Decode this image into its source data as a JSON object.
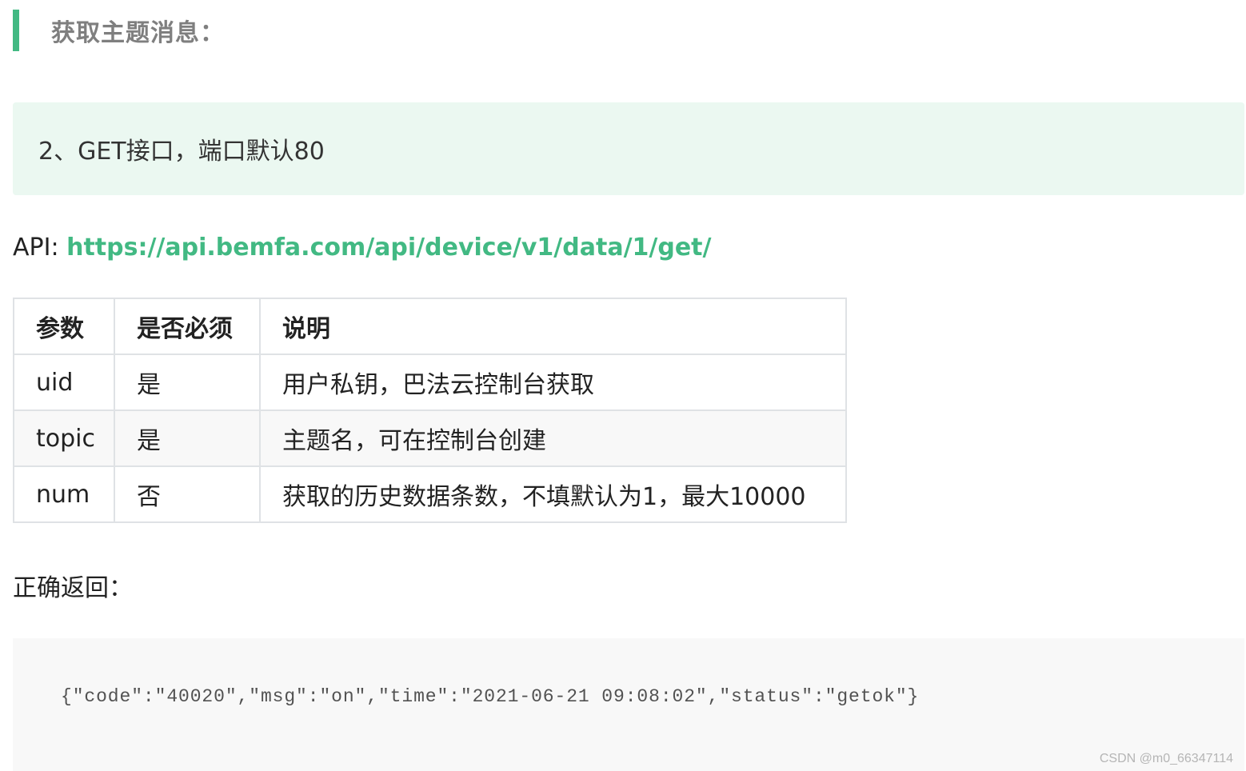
{
  "heading": {
    "text": "获取主题消息："
  },
  "tip": {
    "text": "2、GET接口，端口默认80"
  },
  "api": {
    "label": "API: ",
    "url": "https://api.bemfa.com/api/device/v1/data/1/get/"
  },
  "table": {
    "headers": [
      "参数",
      "是否必须",
      "说明"
    ],
    "rows": [
      [
        "uid",
        "是",
        "用户私钥，巴法云控制台获取"
      ],
      [
        "topic",
        "是",
        "主题名，可在控制台创建"
      ],
      [
        "num",
        "否",
        "获取的历史数据条数，不填默认为1，最大10000"
      ]
    ]
  },
  "return_label": "正确返回：",
  "code": {
    "text": "{\"code\":\"40020\",\"msg\":\"on\",\"time\":\"2021-06-21 09:08:02\",\"status\":\"getok\"}"
  },
  "watermark": "CSDN @m0_66347114",
  "colors": {
    "accent": "#42b983",
    "tip_background": "#ebf8f1",
    "code_background": "#f8f8f8",
    "table_border": "#dfe2e5"
  }
}
